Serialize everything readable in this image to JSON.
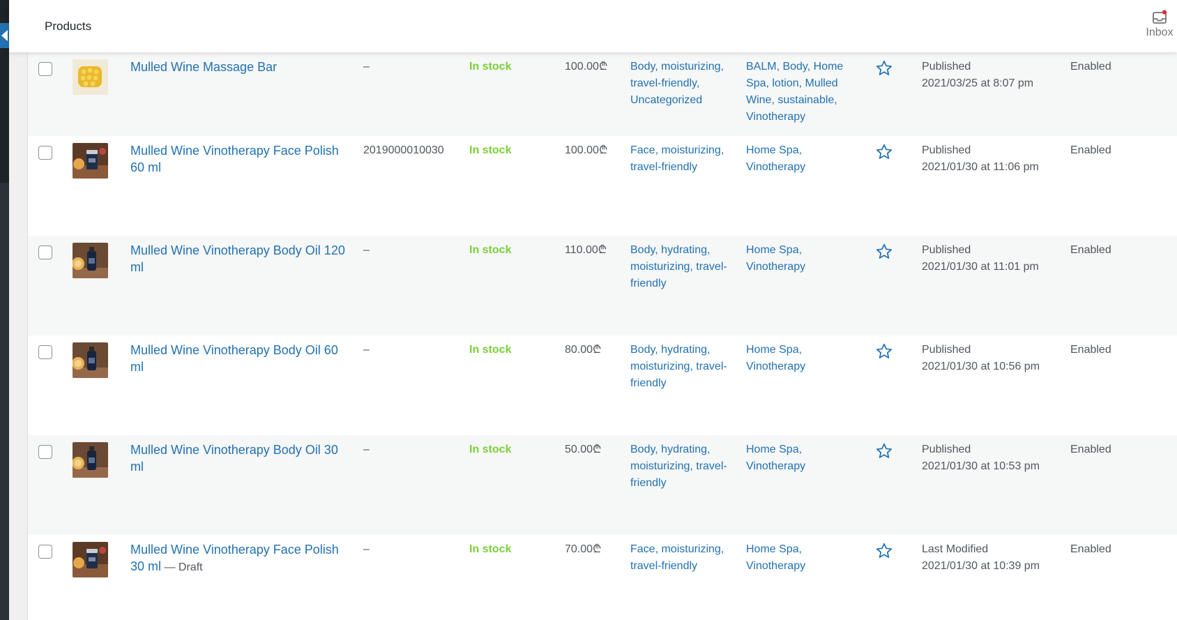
{
  "header": {
    "title": "Products",
    "inbox_label": "Inbox",
    "inbox_icon": "inbox-icon",
    "accent_color": "#2271b1",
    "notification_color": "#d63638"
  },
  "products": [
    {
      "name": "Mulled Wine Massage Bar",
      "draft": "",
      "sku": "–",
      "stock": "In stock",
      "price": "100.00₾",
      "categories": "Body, moisturizing, travel-friendly, Uncategorized",
      "tags": "BALM, Body, Home Spa, lotion, Mulled Wine, sustainable, Vinotherapy",
      "date_status": "Published",
      "date": "2021/03/25 at 8:07 pm",
      "status": "Enabled",
      "thumb": "massage-bar-thumbnail"
    },
    {
      "name": "Mulled Wine Vinotherapy Face Polish 60 ml",
      "draft": "",
      "sku": "2019000010030",
      "stock": "In stock",
      "price": "100.00₾",
      "categories": "Face, moisturizing, travel-friendly",
      "tags": "Home Spa, Vinotherapy",
      "date_status": "Published",
      "date": "2021/01/30 at 11:06 pm",
      "status": "Enabled",
      "thumb": "face-polish-thumbnail"
    },
    {
      "name": "Mulled Wine Vinotherapy Body Oil 120 ml",
      "draft": "",
      "sku": "–",
      "stock": "In stock",
      "price": "110.00₾",
      "categories": "Body, hydrating, moisturizing, travel-friendly",
      "tags": "Home Spa, Vinotherapy",
      "date_status": "Published",
      "date": "2021/01/30 at 11:01 pm",
      "status": "Enabled",
      "thumb": "body-oil-thumbnail"
    },
    {
      "name": "Mulled Wine Vinotherapy Body Oil 60 ml",
      "draft": "",
      "sku": "–",
      "stock": "In stock",
      "price": "80.00₾",
      "categories": "Body, hydrating, moisturizing, travel-friendly",
      "tags": "Home Spa, Vinotherapy",
      "date_status": "Published",
      "date": "2021/01/30 at 10:56 pm",
      "status": "Enabled",
      "thumb": "body-oil-thumbnail"
    },
    {
      "name": "Mulled Wine Vinotherapy Body Oil 30 ml",
      "draft": "",
      "sku": "–",
      "stock": "In stock",
      "price": "50.00₾",
      "categories": "Body, hydrating, moisturizing, travel-friendly",
      "tags": "Home Spa, Vinotherapy",
      "date_status": "Published",
      "date": "2021/01/30 at 10:53 pm",
      "status": "Enabled",
      "thumb": "body-oil-thumbnail"
    },
    {
      "name": "Mulled Wine Vinotherapy Face Polish 30 ml",
      "draft": " — Draft",
      "sku": "–",
      "stock": "In stock",
      "price": "70.00₾",
      "categories": "Face, moisturizing, travel-friendly",
      "tags": "Home Spa, Vinotherapy",
      "date_status": "Last Modified",
      "date": "2021/01/30 at 10:39 pm",
      "status": "Enabled",
      "thumb": "face-polish-thumbnail"
    }
  ]
}
